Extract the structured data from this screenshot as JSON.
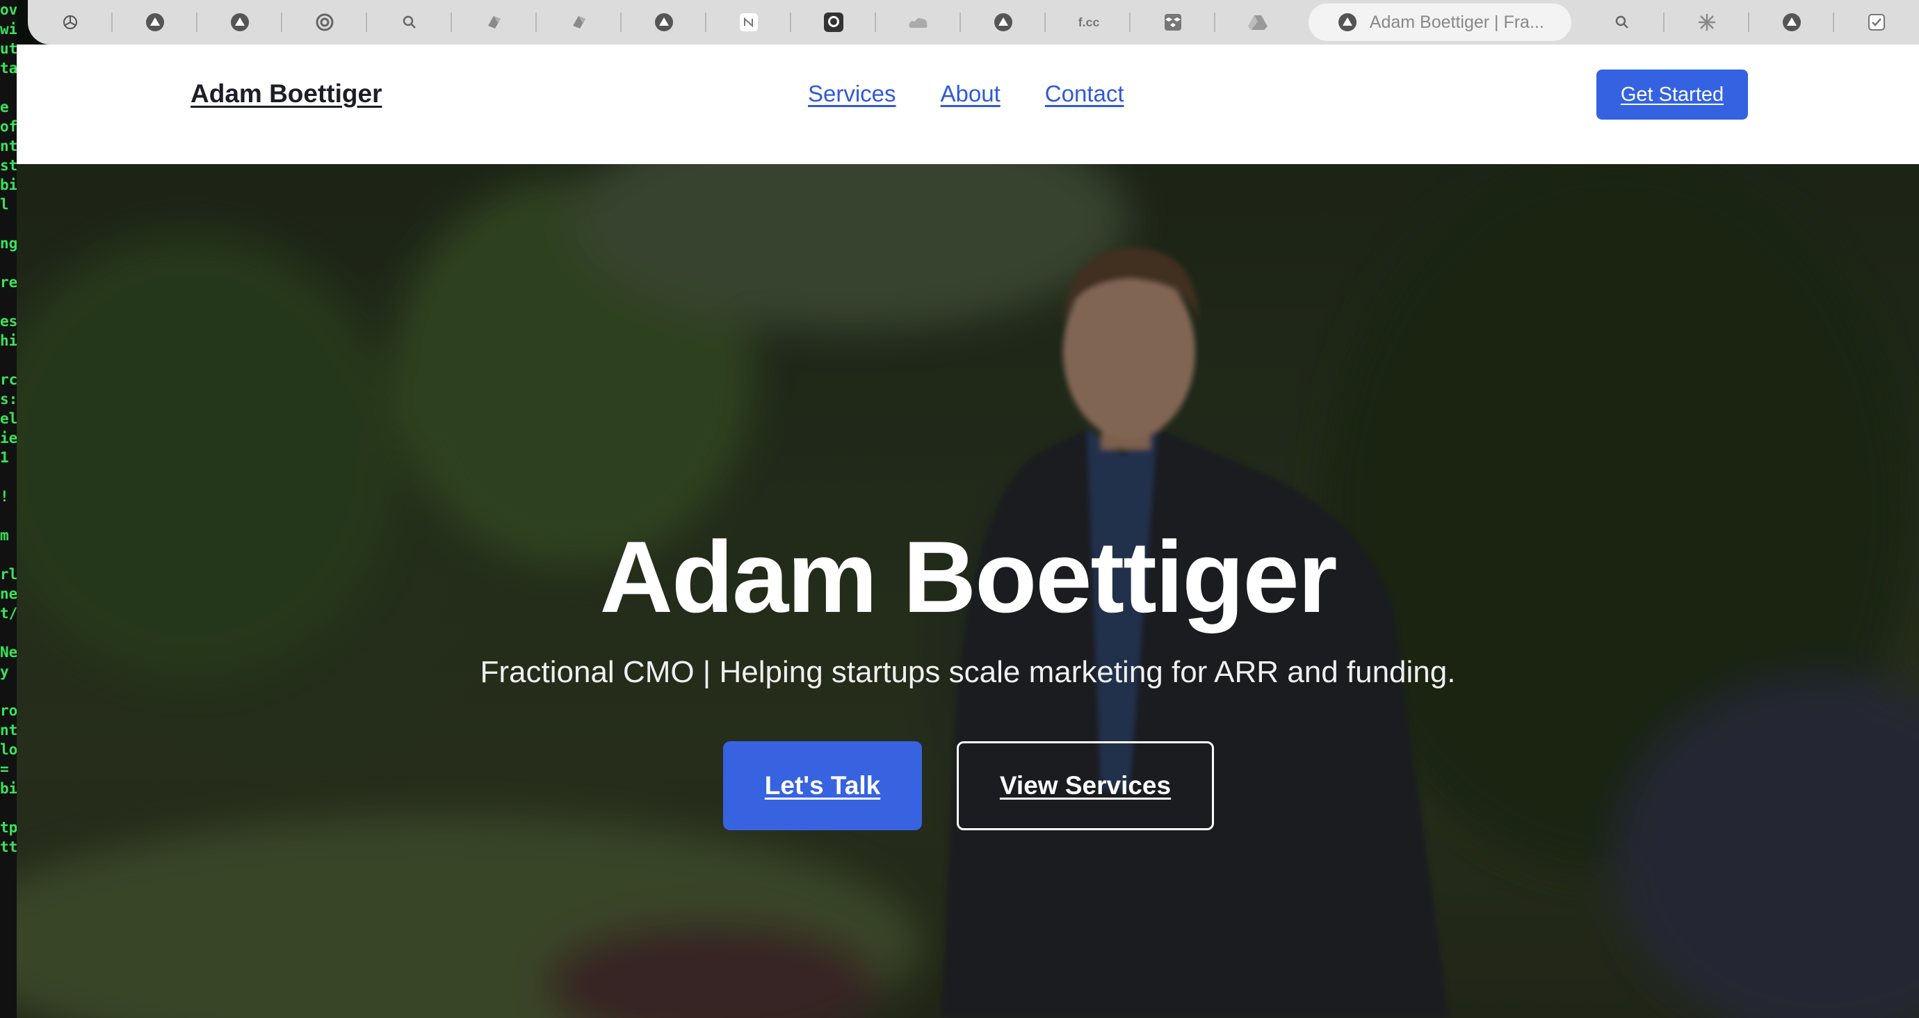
{
  "browser": {
    "tabs": [
      {
        "icon": "openai-icon"
      },
      {
        "icon": "vercel-icon"
      },
      {
        "icon": "vercel-icon"
      },
      {
        "icon": "circle-c-icon"
      },
      {
        "icon": "search-icon"
      },
      {
        "icon": "cube-icon"
      },
      {
        "icon": "cube-icon"
      },
      {
        "icon": "vercel-icon"
      },
      {
        "icon": "notion-icon"
      },
      {
        "icon": "github-icon"
      },
      {
        "icon": "cloud-icon"
      },
      {
        "icon": "vercel-icon"
      },
      {
        "icon": "fcc-icon"
      },
      {
        "icon": "dropbox-icon"
      },
      {
        "icon": "drive-icon"
      }
    ],
    "active_tab": {
      "icon": "vercel-icon",
      "title": "Adam Boettiger | Fra..."
    },
    "tabs_after": [
      {
        "icon": "search-icon"
      },
      {
        "icon": "sparkle-icon"
      },
      {
        "icon": "vercel-icon"
      },
      {
        "icon": "checklist-icon"
      }
    ]
  },
  "terminal": {
    "lines": [
      "ov",
      "wi",
      "ut",
      "ta",
      "",
      "e",
      "of",
      "nt",
      "st",
      "bi",
      "l",
      "",
      "ng",
      "",
      "re",
      "",
      "es",
      "hi",
      "",
      "rc",
      "s:",
      "el",
      "ie",
      "1",
      "",
      "!",
      "",
      "m",
      "",
      "rl",
      "ne",
      "t/",
      "",
      "Ne",
      "y",
      "",
      "ro",
      "nt",
      "lo",
      "=",
      "bi",
      "",
      "tp",
      "tt"
    ]
  },
  "header": {
    "brand": "Adam Boettiger",
    "nav": [
      {
        "label": "Services"
      },
      {
        "label": "About"
      },
      {
        "label": "Contact"
      }
    ],
    "cta": "Get Started"
  },
  "hero": {
    "title": "Adam Boettiger",
    "subtitle": "Fractional CMO | Helping startups scale marketing for ARR and funding.",
    "primary_button": "Let's Talk",
    "secondary_button": "View Services"
  },
  "colors": {
    "accent": "#3462e0",
    "link": "#2f59d9",
    "tabbar": "#dcdcdc"
  }
}
